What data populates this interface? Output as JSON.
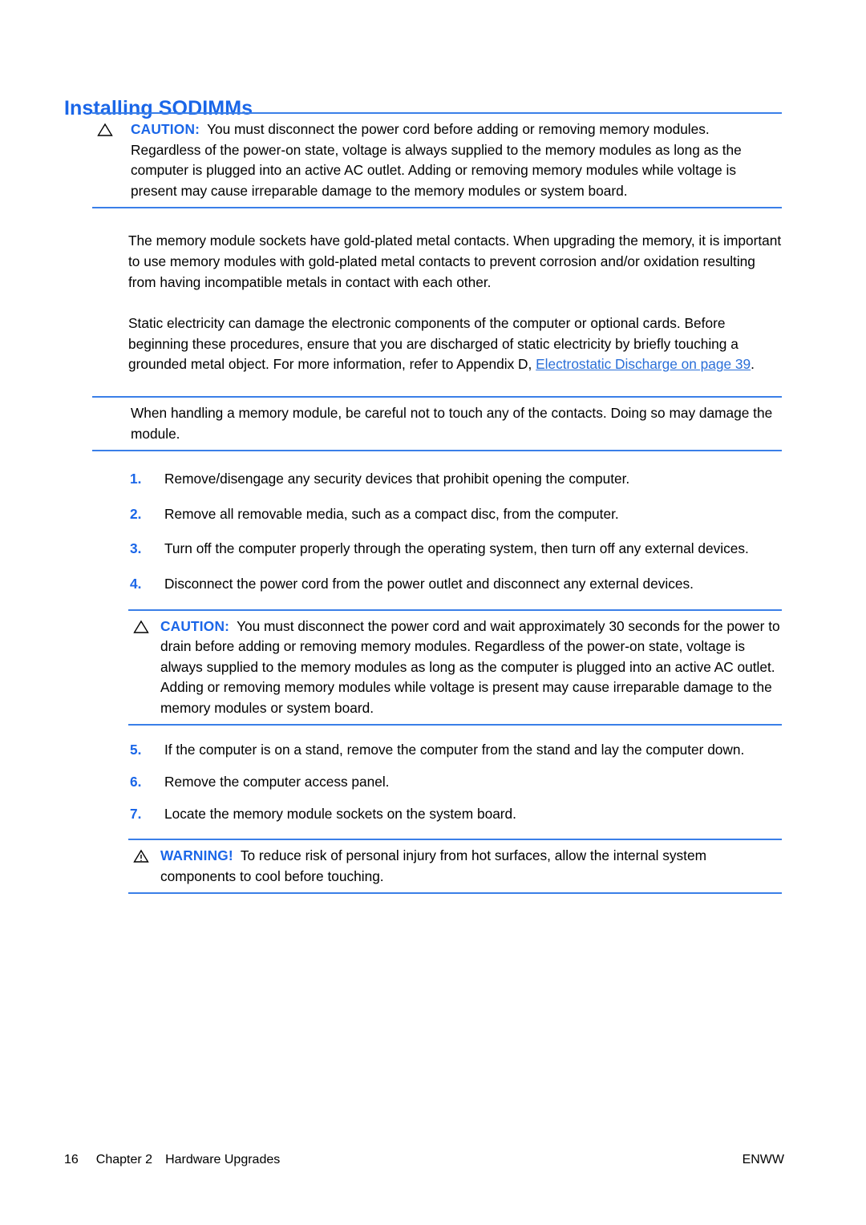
{
  "document": {
    "heading": "Installing SODIMMs"
  },
  "caution1": {
    "icon": "caution-triangle-icon",
    "label": "CAUTION:",
    "text": "You must disconnect the power cord before adding or removing memory modules. Regardless of the power-on state, voltage is always supplied to the memory modules as long as the computer is plugged into an active AC outlet. Adding or removing memory modules while voltage is present may cause irreparable damage to the memory modules or system board."
  },
  "paragraphs": {
    "p1": "The memory module sockets have gold-plated metal contacts. When upgrading the memory, it is important to use memory modules with gold-plated metal contacts to prevent corrosion and/or oxidation resulting from having incompatible metals in contact with each other.",
    "p2_before_link": "Static electricity can damage the electronic components of the computer or optional cards. Before beginning these procedures, ensure that you are discharged of static electricity by briefly touching a grounded metal object. For more information, refer to Appendix D, ",
    "p2_link": "Electrostatic Discharge on page 39",
    "p2_after_link": "."
  },
  "note1": {
    "text": "When handling a memory module, be careful not to touch any of the contacts. Doing so may damage the module."
  },
  "steps": [
    {
      "number": "1.",
      "text": "Remove/disengage any security devices that prohibit opening the computer."
    },
    {
      "number": "2.",
      "text": "Remove all removable media, such as a compact disc, from the computer."
    },
    {
      "number": "3.",
      "text": "Turn off the computer properly through the operating system, then turn off any external devices."
    },
    {
      "number": "4.",
      "text": "Disconnect the power cord from the power outlet and disconnect any external devices."
    },
    {
      "number": "5.",
      "text": "If the computer is on a stand, remove the computer from the stand and lay the computer down."
    },
    {
      "number": "6.",
      "text": "Remove the computer access panel."
    },
    {
      "number": "7.",
      "text": "Locate the memory module sockets on the system board."
    }
  ],
  "caution2": {
    "icon": "caution-triangle-icon",
    "label": "CAUTION:",
    "text": "You must disconnect the power cord and wait approximately 30 seconds for the power to drain before adding or removing memory modules. Regardless of the power-on state, voltage is always supplied to the memory modules as long as the computer is plugged into an active AC outlet. Adding or removing memory modules while voltage is present may cause irreparable damage to the memory modules or system board."
  },
  "warning": {
    "icon": "warning-triangle-icon",
    "label": "WARNING!",
    "text": "To reduce risk of personal injury from hot surfaces, allow the internal system components to cool before touching."
  },
  "footer": {
    "page_number": "16",
    "chapter": "Chapter 2",
    "chapter_title": "Hardware Upgrades",
    "right": "ENWW"
  },
  "colors": {
    "accent_blue": "#1a66e8",
    "rule_blue": "#3a7fe8",
    "link_blue": "#2a6fd8"
  }
}
